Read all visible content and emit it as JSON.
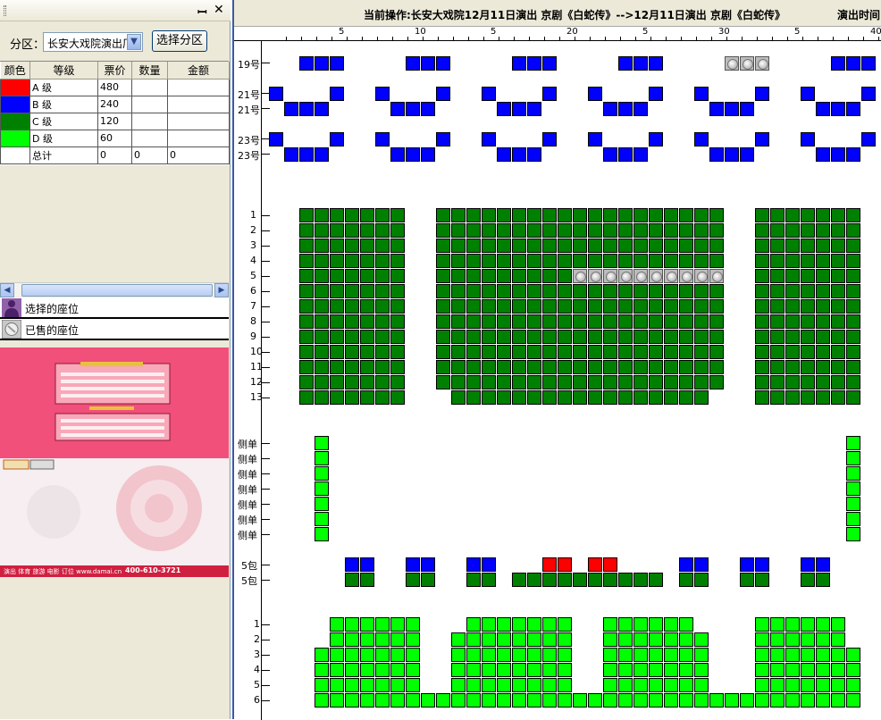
{
  "left_panel": {
    "pin_icon": "pin-icon",
    "close_icon": "close-icon",
    "zone_label": "分区：",
    "zone_select_value": "长安大戏院演出厂",
    "zone_button": "选择分区",
    "table": {
      "headers": [
        "颜色",
        "等级",
        "票价",
        "数量",
        "金额"
      ],
      "rows": [
        {
          "color": "#ff0000",
          "level": "A 级",
          "price": "480",
          "qty": "",
          "amount": ""
        },
        {
          "color": "#0000ff",
          "level": "B 级",
          "price": "240",
          "qty": "",
          "amount": ""
        },
        {
          "color": "#008000",
          "level": "C 级",
          "price": "120",
          "qty": "",
          "amount": ""
        },
        {
          "color": "#00ff00",
          "level": "D 级",
          "price": "60",
          "qty": "",
          "amount": ""
        },
        {
          "color": "#ffffff",
          "level": "总计",
          "price": "0",
          "qty": "0",
          "amount": "0"
        }
      ]
    },
    "legend": {
      "selected": "选择的座位",
      "sold": "已售的座位"
    },
    "poster_phone": "400-610-3721",
    "poster_web": "演出 体育 旅游 电影 订位 www.damai.cn"
  },
  "right_panel": {
    "operation": "当前操作:长安大戏院12月11日演出 京剧《白蛇传》-->12月11日演出 京剧《白蛇传》",
    "time_label": "演出时间",
    "ruler_labels": [
      "5",
      "10",
      "5",
      "20",
      "5",
      "30",
      "5",
      "40"
    ],
    "row_labels": {
      "r19": "19号",
      "r21a": "21号",
      "r21b": "21号",
      "r23a": "23号",
      "r23b": "23号",
      "main": [
        "1",
        "2",
        "3",
        "4",
        "5",
        "6",
        "7",
        "8",
        "9",
        "10",
        "11",
        "12",
        "13"
      ],
      "side": [
        "侧单",
        "侧单",
        "侧单",
        "侧单",
        "侧单",
        "侧单",
        "侧单"
      ],
      "box1": "5包",
      "box2": "5包",
      "back": [
        "1",
        "2",
        "3",
        "4",
        "5",
        "6"
      ]
    }
  }
}
